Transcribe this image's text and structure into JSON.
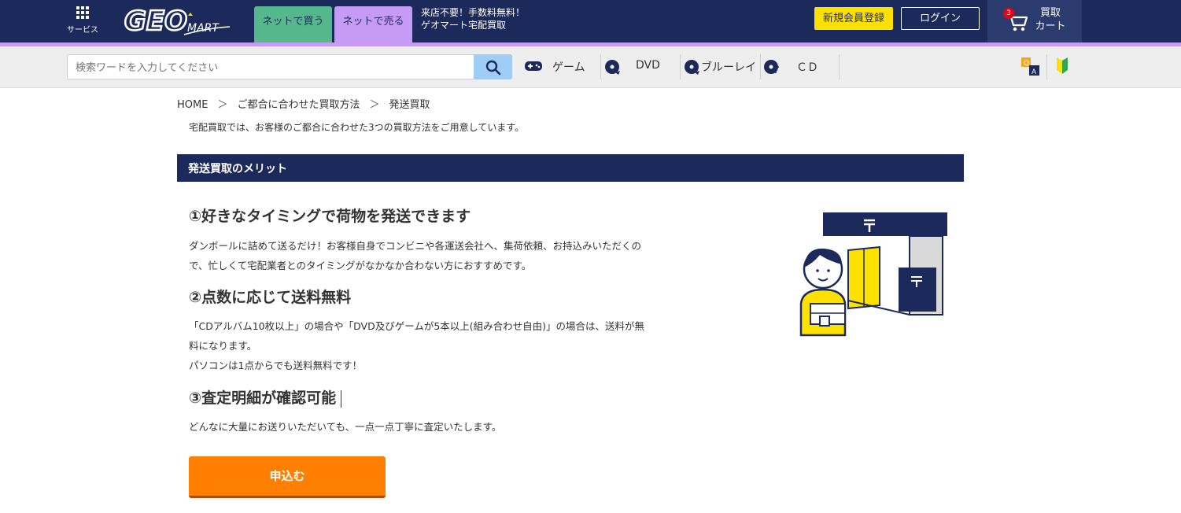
{
  "header": {
    "service_label": "サービス",
    "logo_text": "GEO",
    "logo_sub": "MART",
    "tab_buy": "ネットで買う",
    "tab_sell": "ネットで売る",
    "promo_line1": "来店不要！手数料無料！",
    "promo_line2": "ゲオマート宅配買取",
    "register_label": "新規会員登録",
    "login_label": "ログイン",
    "cart_badge": "3",
    "cart_line1": "買取",
    "cart_line2": "カート",
    "colors": {
      "navy": "#1c2a5b",
      "buy_tab": "#55b88c",
      "sell_tab": "#c59bf5",
      "register": "#ffe100"
    }
  },
  "search": {
    "placeholder": "検索ワードを入力してください",
    "button_icon": "search-icon"
  },
  "categories": [
    {
      "label": "ゲーム",
      "icon": "gamepad-icon"
    },
    {
      "label": "DVD",
      "icon": "dvd-icon"
    },
    {
      "label": "ブルーレイ",
      "icon": "bluray-icon"
    },
    {
      "label": "ＣＤ",
      "icon": "cd-icon"
    }
  ],
  "breadcrumb": {
    "items": [
      "HOME",
      "ご都合に合わせた買取方法",
      "発送買取"
    ],
    "separator": "＞"
  },
  "intro": "宅配買取では、お客様のご都合に合わせた3つの買取方法をご用意しています。",
  "section_title": "発送買取のメリット",
  "merits": [
    {
      "title": "①好きなタイミングで荷物を発送できます",
      "lines": [
        "ダンボールに詰めて送るだけ！お客様自身でコンビニや各運送会社へ、集荷依頼、お持込みいただくの",
        "で、忙しくて宅配業者とのタイミングがなかなか合わない方におすすめです。"
      ]
    },
    {
      "title": "②点数に応じて送料無料",
      "lines": [
        "「CDアルバム10枚以上」の場合や「DVD及びゲームが5本以上(組み合わせ自由)」の場合は、送料が無",
        "料になります。",
        "パソコンは1点からでも送料無料です！"
      ]
    },
    {
      "title": "③査定明細が確認可能",
      "lines": [
        "どんなに大量にお送りいただいても、一点一点丁寧に査定いたします。"
      ]
    }
  ],
  "apply_label": "申込む",
  "accent_colors": {
    "apply": "#ff7f00",
    "illustration_yellow": "#ffe100"
  }
}
